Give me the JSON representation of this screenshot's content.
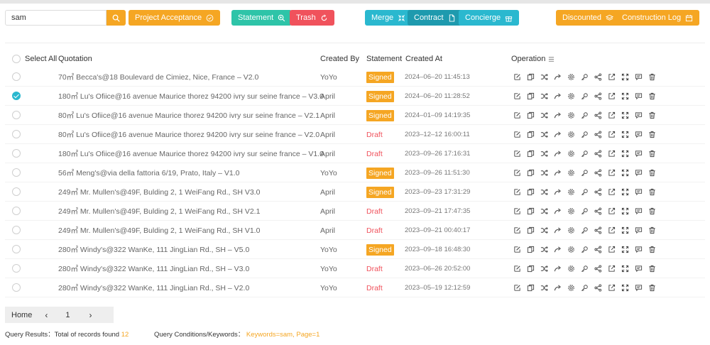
{
  "toolbar": {
    "search_value": "sam",
    "buttons": {
      "project_acceptance": "Project Acceptance",
      "statement": "Statement",
      "trash": "Trash",
      "merge": "Merge",
      "contract": "Contract",
      "concierge": "Concierge",
      "discounted": "Discounted",
      "construction_log": "Construction Log"
    }
  },
  "colors": {
    "orange": "#f5a623",
    "green": "#2ec4a8",
    "red": "#f0525c",
    "cyan": "#2ab8cf",
    "teal": "#1e9aae"
  },
  "table": {
    "headers": {
      "select_all": "Select All",
      "quotation": "Quotation",
      "created_by": "Created By",
      "statement": "Statement",
      "created_at": "Created At",
      "operation": "Operation"
    },
    "rows": [
      {
        "quotation": "70㎡ Becca's@18 Boulevard de Cimiez, Nice, France – V2.0",
        "created_by": "YoYo",
        "statement": "Signed",
        "created_at": "2024–06–20 11:45:13",
        "checked": false
      },
      {
        "quotation": "180㎡ Lu's Ofiice@16 avenue Maurice thorez 94200 ivry sur seine france – V3.0",
        "created_by": "April",
        "statement": "Signed",
        "created_at": "2024–06–20 11:28:52",
        "checked": true
      },
      {
        "quotation": "80㎡ Lu's Ofiice@16 avenue Maurice thorez 94200 ivry sur seine france – V2.1",
        "created_by": "April",
        "statement": "Signed",
        "created_at": "2024–01–09 14:19:35",
        "checked": false
      },
      {
        "quotation": "80㎡ Lu's Ofiice@16 avenue Maurice thorez 94200 ivry sur seine france – V2.0",
        "created_by": "April",
        "statement": "Draft",
        "created_at": "2023–12–12 16:00:11",
        "checked": false
      },
      {
        "quotation": "180㎡ Lu's Ofiice@16 avenue Maurice thorez 94200 ivry sur seine france – V1.0",
        "created_by": "April",
        "statement": "Draft",
        "created_at": "2023–09–26 17:16:31",
        "checked": false
      },
      {
        "quotation": "56㎡ Meng's@via della fattoria 6/19, Prato, Italy – V1.0",
        "created_by": "YoYo",
        "statement": "Signed",
        "created_at": "2023–09–26 11:51:30",
        "checked": false
      },
      {
        "quotation": "249㎡ Mr. Mullen's@49F, Bulding 2, 1 WeiFang Rd., SH V3.0",
        "created_by": "April",
        "statement": "Signed",
        "created_at": "2023–09–23 17:31:29",
        "checked": false
      },
      {
        "quotation": "249㎡ Mr. Mullen's@49F, Bulding 2, 1 WeiFang Rd., SH V2.1",
        "created_by": "April",
        "statement": "Draft",
        "created_at": "2023–09–21 17:47:35",
        "checked": false
      },
      {
        "quotation": "249㎡ Mr. Mullen's@49F, Bulding 2, 1 WeiFang Rd., SH V1.0",
        "created_by": "April",
        "statement": "Draft",
        "created_at": "2023–09–21 00:40:17",
        "checked": false
      },
      {
        "quotation": "280㎡ Windy's@322 WanKe, 111 JingLian Rd., SH – V5.0",
        "created_by": "YoYo",
        "statement": "Signed",
        "created_at": "2023–09–18 16:48:30",
        "checked": false
      },
      {
        "quotation": "280㎡ Windy's@322 WanKe, 111 JingLian Rd., SH – V3.0",
        "created_by": "YoYo",
        "statement": "Draft",
        "created_at": "2023–06–26 20:52:00",
        "checked": false
      },
      {
        "quotation": "280㎡ Windy's@322 WanKe, 111 JingLian Rd., SH – V2.0",
        "created_by": "YoYo",
        "statement": "Draft",
        "created_at": "2023–05–19 12:12:59",
        "checked": false
      }
    ],
    "operation_icons": [
      "edit-icon",
      "copy-icon",
      "shuffle-icon",
      "share-arrow-icon",
      "settings-icon",
      "key-icon",
      "share-nodes-icon",
      "export-icon",
      "expand-icon",
      "comment-icon",
      "delete-icon"
    ]
  },
  "pagination": {
    "home": "Home",
    "prev": "‹",
    "page": "1",
    "next": "›"
  },
  "footer": {
    "results_label": "Query Results：Total of records found",
    "results_count": "12",
    "conditions_label": "Query Conditions/Keywords：",
    "conditions_value": "Keywords=sam, Page=1"
  }
}
